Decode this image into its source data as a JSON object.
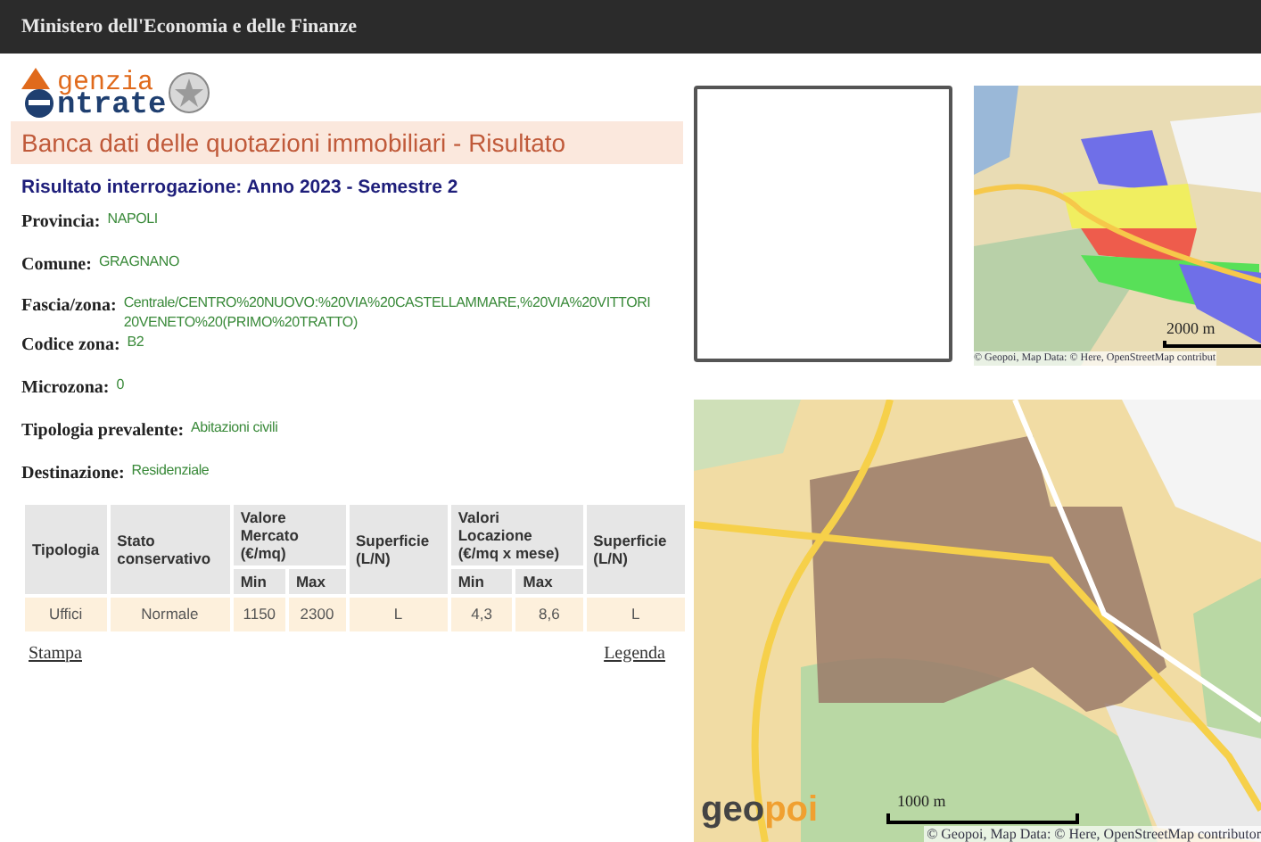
{
  "header": {
    "title": "Ministero dell'Economia e delle Finanze"
  },
  "logo": {
    "top": "genzia",
    "bottom": "ntrate"
  },
  "banner": {
    "title": "Banca dati delle quotazioni immobiliari - Risultato"
  },
  "result_title": "Risultato interrogazione: Anno 2023 - Semestre 2",
  "fields": [
    {
      "label": "Provincia:",
      "value_lines": [
        "NAPOLI"
      ]
    },
    {
      "label": "Comune:",
      "value_lines": [
        "GRAGNANO"
      ]
    },
    {
      "label": "Fascia/zona:",
      "value_lines": [
        "Centrale/CENTRO%20NUOVO:%20VIA%20CASTELLAMMARE,%20VIA%20VITTORI",
        "20VENETO%20(PRIMO%20TRATTO)"
      ]
    },
    {
      "label": "Codice zona:",
      "value_lines": [
        "B2"
      ]
    },
    {
      "label": "Microzona:",
      "value_lines": [
        "0"
      ]
    },
    {
      "label": "Tipologia prevalente:",
      "value_lines": [
        "Abitazioni civili"
      ]
    },
    {
      "label": "Destinazione:",
      "value_lines": [
        "Residenziale"
      ]
    }
  ],
  "table": {
    "header_rows": [
      [
        {
          "label": "Tipologia",
          "rowspan": 2
        },
        {
          "label": "Stato conservativo",
          "rowspan": 2
        },
        {
          "label": "Valore Mercato (€/mq)",
          "colspan": 2
        },
        {
          "label": "Superficie (L/N)",
          "rowspan": 2
        },
        {
          "label": "Valori Locazione (€/mq x mese)",
          "colspan": 2
        },
        {
          "label": "Superficie (L/N)",
          "rowspan": 2
        }
      ],
      [
        {
          "label": "Min"
        },
        {
          "label": "Max"
        },
        {
          "label": "Min"
        },
        {
          "label": "Max"
        }
      ]
    ],
    "rows": [
      [
        "Uffici",
        "Normale",
        "1150",
        "2300",
        "L",
        "4,3",
        "8,6",
        "L"
      ]
    ]
  },
  "links": [
    "Stampa",
    "Legenda"
  ],
  "map_small": {
    "scale": "2000 m",
    "attribution": "© Geopoi, Map Data: © Here, OpenStreetMap contribut"
  },
  "map_large": {
    "scale": "1000 m",
    "attribution": "© Geopoi, Map Data: © Here, OpenStreetMap contributor",
    "brand": {
      "part_1": "geo",
      "part_2": "poi"
    }
  }
}
